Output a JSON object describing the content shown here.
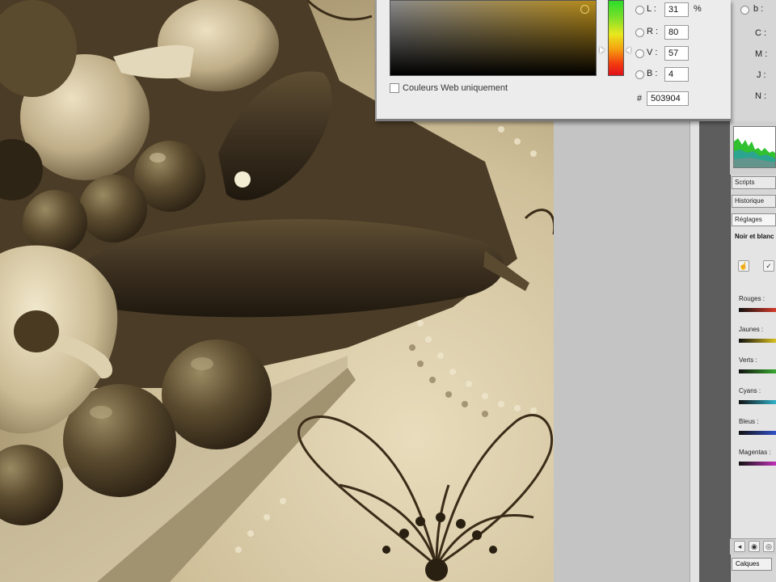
{
  "color_picker": {
    "fields_left": [
      {
        "label": "L :",
        "value": "31",
        "unit": "%"
      },
      {
        "label": "R :",
        "value": "80",
        "unit": ""
      },
      {
        "label": "V :",
        "value": "57",
        "unit": ""
      },
      {
        "label": "B :",
        "value": "4",
        "unit": ""
      }
    ],
    "hex_label": "#",
    "hex_value": "503904",
    "fields_right": [
      "b :",
      "C :",
      "M :",
      "J :",
      "N :"
    ],
    "web_colors_label": "Couleurs Web uniquement",
    "web_colors_checked": false,
    "current_color": "#503904"
  },
  "panels": {
    "tabs": [
      "Scripts",
      "Historique",
      "Réglages"
    ],
    "adjustment_title": "Noir et blanc",
    "sliders": [
      {
        "label": "Rouges :",
        "color": "#d43a2a"
      },
      {
        "label": "Jaunes :",
        "color": "#d8c020"
      },
      {
        "label": "Verts :",
        "color": "#38a830"
      },
      {
        "label": "Cyans :",
        "color": "#30b0c8"
      },
      {
        "label": "Bleus :",
        "color": "#3050c8"
      },
      {
        "label": "Magentas :",
        "color": "#c030b8"
      }
    ],
    "layers_tab": "Calques"
  }
}
